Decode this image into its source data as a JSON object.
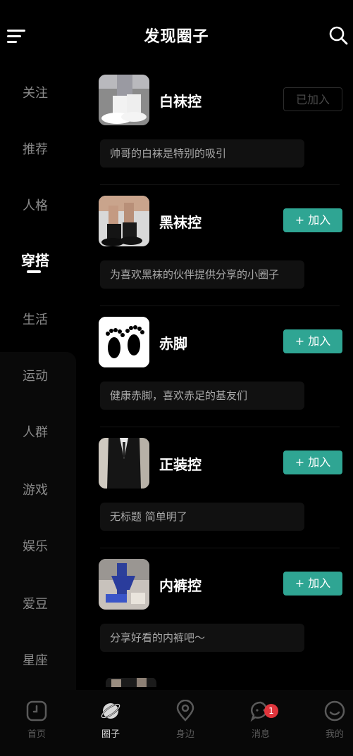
{
  "header": {
    "title": "发现圈子"
  },
  "sidebar": {
    "items": [
      {
        "label": "关注",
        "active": false
      },
      {
        "label": "推荐",
        "active": false
      },
      {
        "label": "人格",
        "active": false
      },
      {
        "label": "穿搭",
        "active": true
      },
      {
        "label": "生活",
        "active": false
      },
      {
        "label": "运动",
        "active": false
      },
      {
        "label": "人群",
        "active": false
      },
      {
        "label": "游戏",
        "active": false
      },
      {
        "label": "娱乐",
        "active": false
      },
      {
        "label": "爱豆",
        "active": false
      },
      {
        "label": "星座",
        "active": false
      }
    ]
  },
  "circles": [
    {
      "name": "白袜控",
      "button": "已加入",
      "joined": true,
      "desc": "帅哥的白袜是特别的吸引",
      "thumb_icon": "white-socks-photo"
    },
    {
      "name": "黑袜控",
      "button": "+ 加入",
      "joined": false,
      "desc": "为喜欢黑袜的伙伴提供分享的小圈子",
      "thumb_icon": "black-socks-photo"
    },
    {
      "name": "赤脚",
      "button": "+ 加入",
      "joined": false,
      "desc": "健康赤脚，喜欢赤足的基友们",
      "thumb_icon": "footprints-icon"
    },
    {
      "name": "正装控",
      "button": "+ 加入",
      "joined": false,
      "desc": "无标题 简单明了",
      "thumb_icon": "suit-photo"
    },
    {
      "name": "内裤控",
      "button": "+ 加入",
      "joined": false,
      "desc": "分享好看的内裤吧～",
      "thumb_icon": "underwear-photo"
    }
  ],
  "tabs": [
    {
      "label": "首页",
      "icon": "home-icon",
      "active": false
    },
    {
      "label": "圈子",
      "icon": "planet-icon",
      "active": true
    },
    {
      "label": "身边",
      "icon": "location-pin-icon",
      "active": false
    },
    {
      "label": "消息",
      "icon": "chat-bubble-icon",
      "active": false,
      "badge": "1"
    },
    {
      "label": "我的",
      "icon": "profile-face-icon",
      "active": false
    }
  ],
  "colors": {
    "accent": "#2fa593",
    "badge": "#e0353c",
    "background": "#000000"
  }
}
